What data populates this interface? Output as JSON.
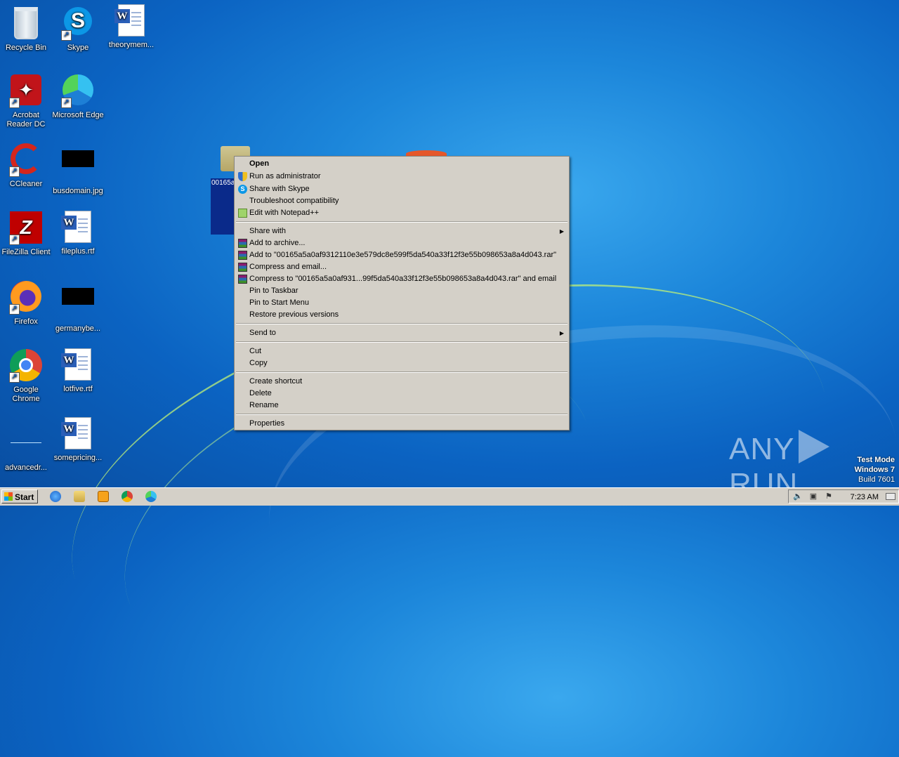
{
  "desktop": {
    "icons": [
      {
        "label": "Recycle Bin"
      },
      {
        "label": "Skype"
      },
      {
        "label": "theorymem..."
      },
      {
        "label": "Acrobat Reader DC"
      },
      {
        "label": "Microsoft Edge"
      },
      {
        "label": "CCleaner"
      },
      {
        "label": "busdomain.jpg"
      },
      {
        "label": "FileZilla Client"
      },
      {
        "label": "fileplus.rtf"
      },
      {
        "label": "Firefox"
      },
      {
        "label": "germanybe..."
      },
      {
        "label": "Google Chrome"
      },
      {
        "label": "lotfive.rtf"
      },
      {
        "label": "advancedr..."
      },
      {
        "label": "somepricing..."
      }
    ],
    "selected_file_label": "00165a5a0af9312110e3e579dc8e599f5da540a33f12f3e55b098653a8a4d043"
  },
  "context_menu": {
    "open": "Open",
    "run_as_admin": "Run as administrator",
    "share_skype": "Share with Skype",
    "troubleshoot": "Troubleshoot compatibility",
    "edit_notepad": "Edit with Notepad++",
    "share_with": "Share with",
    "add_archive": "Add to archive...",
    "add_to_rar": "Add to \"00165a5a0af9312110e3e579dc8e599f5da540a33f12f3e55b098653a8a4d043.rar\"",
    "compress_email": "Compress and email...",
    "compress_to_rar_email": "Compress to \"00165a5a0af931...99f5da540a33f12f3e55b098653a8a4d043.rar\" and email",
    "pin_taskbar": "Pin to Taskbar",
    "pin_start": "Pin to Start Menu",
    "restore_versions": "Restore previous versions",
    "send_to": "Send to",
    "cut": "Cut",
    "copy": "Copy",
    "create_shortcut": "Create shortcut",
    "delete": "Delete",
    "rename": "Rename",
    "properties": "Properties"
  },
  "watermark": {
    "left": "ANY",
    "right": "RUN",
    "test_mode": "Test Mode",
    "os": "Windows 7",
    "build": "Build 7601"
  },
  "taskbar": {
    "start_label": "Start",
    "clock": "7:23 AM"
  }
}
